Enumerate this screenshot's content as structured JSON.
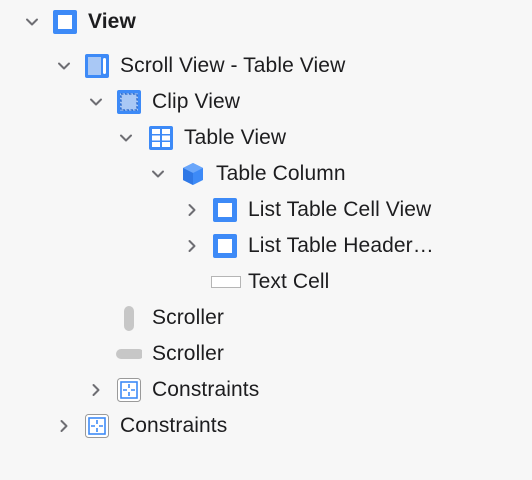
{
  "tree": {
    "root": {
      "label": "View",
      "icon": "view-icon"
    },
    "scroll_view": {
      "label": "Scroll View - Table View",
      "icon": "scroll-view-icon"
    },
    "clip_view": {
      "label": "Clip View",
      "icon": "clip-view-icon"
    },
    "table_view": {
      "label": "Table View",
      "icon": "table-view-icon"
    },
    "table_column": {
      "label": "Table Column",
      "icon": "table-column-cube-icon"
    },
    "list_cell_view": {
      "label": "List Table Cell View",
      "icon": "view-icon"
    },
    "list_header": {
      "label": "List Table Header…",
      "icon": "view-icon"
    },
    "text_cell": {
      "label": "Text Cell",
      "icon": "text-cell-icon"
    },
    "scroller_vertical": {
      "label": "Scroller",
      "icon": "vertical-scroller-icon"
    },
    "scroller_horizontal": {
      "label": "Scroller",
      "icon": "horizontal-scroller-icon"
    },
    "clip_constraints": {
      "label": "Constraints",
      "icon": "constraints-icon"
    },
    "root_constraints": {
      "label": "Constraints",
      "icon": "constraints-icon"
    }
  },
  "colors": {
    "accent": "#3d8af7",
    "accent_light": "#a9c8f5",
    "chevron": "#6e6e73",
    "text": "#1d1d1f"
  }
}
